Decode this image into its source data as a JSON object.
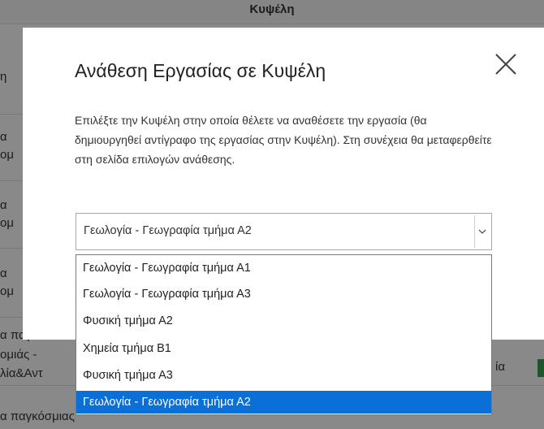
{
  "background": {
    "header_label": "Κυψέλη",
    "fragments": [
      "η",
      "α",
      "ομ",
      "α",
      "ομ",
      "α",
      "ομ",
      "α παγκοσ",
      "ομιάς -",
      "λία&Αντ",
      "ία",
      "α παγκόσμιας"
    ]
  },
  "modal": {
    "title": "Ανάθεση Εργασίας σε Κυψέλη",
    "description": "Επιλέξτε την Κυψέλη στην οποία θέλετε να αναθέσετε την εργασία (θα δημιουργηθεί αντίγραφο της εργασίας στην Κυψέλη). Στη συνέχεια θα μεταφερθείτε στη σελίδα επιλογών ανάθεσης.",
    "select": {
      "value": "Γεωλογία - Γεωγραφία τμήμα Α2",
      "options": [
        "Γεωλογία - Γεωγραφία τμήμα Α1",
        "Γεωλογία - Γεωγραφία τμήμα Α3",
        "Φυσική τμήμα Α2",
        "Χημεία τμήμα Β1",
        "Φυσική τμήμα Α3",
        "Γεωλογία - Γεωγραφία τμήμα Α2"
      ],
      "highlighted_index": 5
    }
  },
  "colors": {
    "highlight": "#0a6fd6",
    "overlay": "rgba(0,0,0,0.45)",
    "status_green": "#3a9a52"
  },
  "icons": {
    "close": "close-icon",
    "dropdown": "chevron-down-icon"
  }
}
